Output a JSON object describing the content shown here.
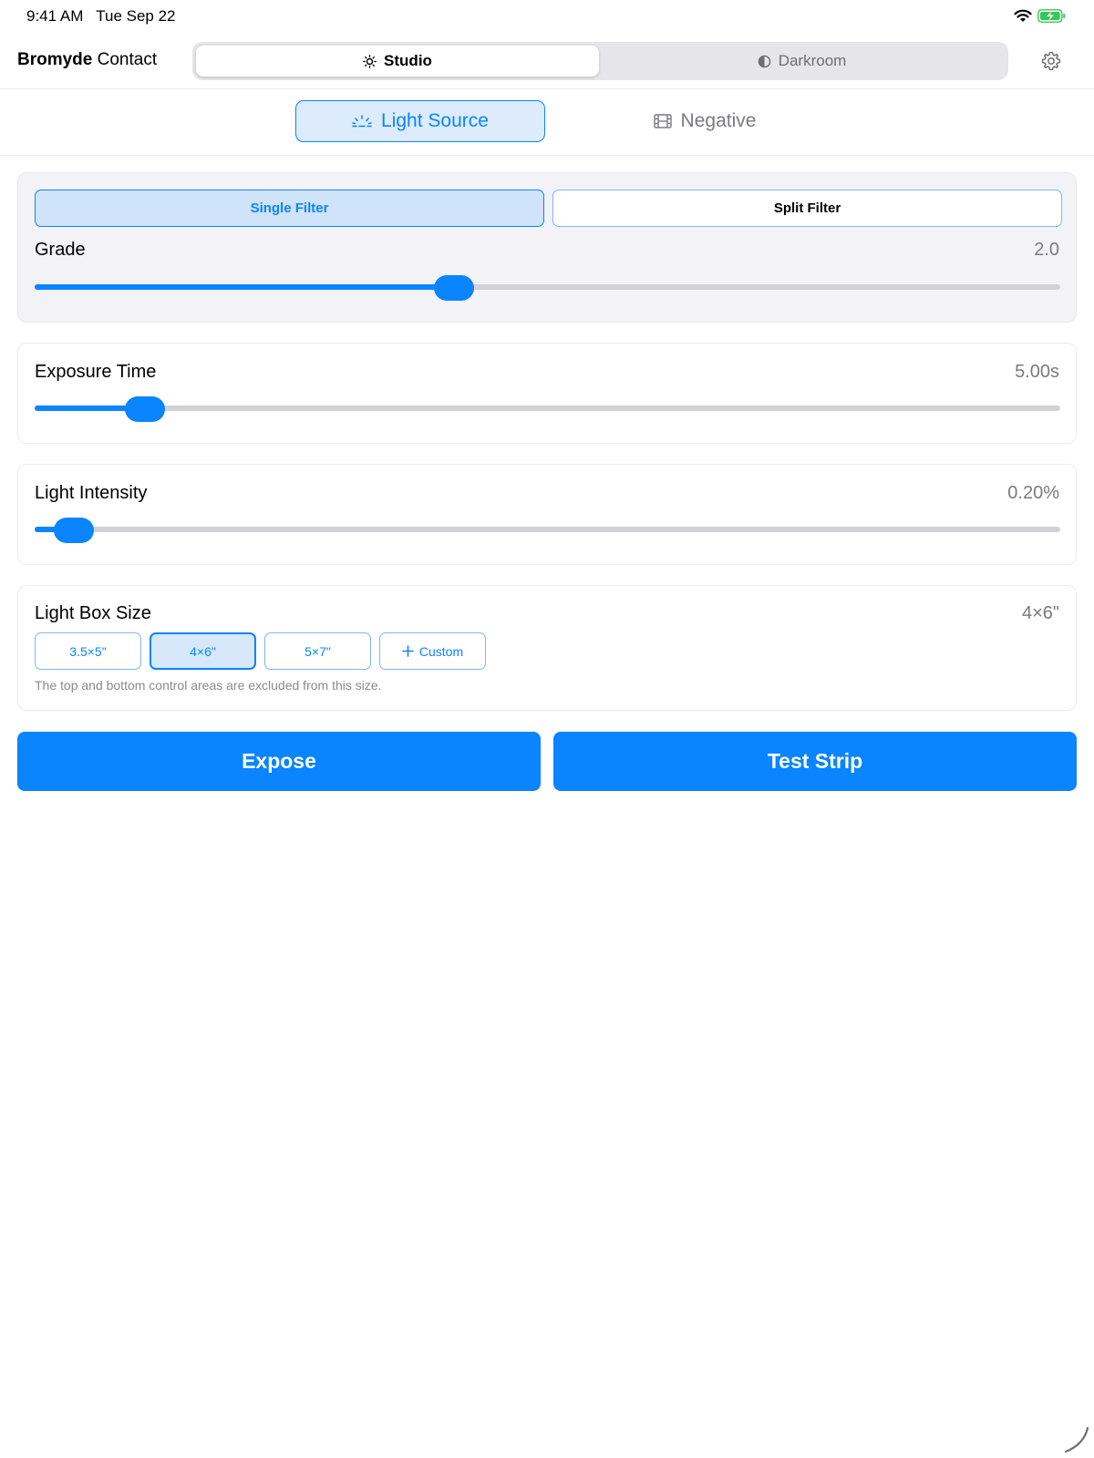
{
  "status_bar": {
    "time": "9:41 AM",
    "date": "Tue Sep 22",
    "icons": [
      "wifi-icon",
      "battery-charging-icon"
    ]
  },
  "header": {
    "brand_bold": "Bromyde",
    "brand_light": "Contact",
    "modes": [
      {
        "label": "Studio",
        "icon": "sun-icon",
        "selected": true
      },
      {
        "label": "Darkroom",
        "icon": "half-circle-icon",
        "selected": false
      }
    ],
    "settings_icon": "gear-icon"
  },
  "sub_tabs": [
    {
      "label": "Light Source",
      "icon": "light-source-icon",
      "selected": true
    },
    {
      "label": "Negative",
      "icon": "film-icon",
      "selected": false
    }
  ],
  "filter": {
    "options": [
      "Single Filter",
      "Split Filter"
    ],
    "selected": "Single Filter",
    "grade_label": "Grade",
    "grade_value": "2.0",
    "grade_fraction": 0.405
  },
  "exposure": {
    "label": "Exposure Time",
    "value": "5.00s",
    "fraction": 0.092
  },
  "intensity": {
    "label": "Light Intensity",
    "value": "0.20%",
    "fraction": 0.019
  },
  "light_box": {
    "label": "Light Box Size",
    "value": "4×6\"",
    "options": [
      "3.5×5\"",
      "4×6\"",
      "5×7\""
    ],
    "custom_label": "Custom",
    "selected": "4×6\"",
    "note": "The top and bottom control areas are excluded from this size."
  },
  "actions": {
    "expose": "Expose",
    "test_strip": "Test Strip"
  },
  "colors": {
    "accent": "#0a84ff",
    "track": "#d1d1d6",
    "secondary_text": "#7a7a80"
  }
}
